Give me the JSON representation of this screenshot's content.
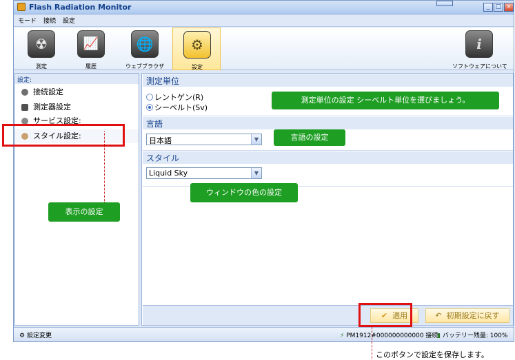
{
  "window": {
    "title": "Flash Radiation Monitor",
    "buttons": [
      "_",
      "□",
      "×"
    ]
  },
  "menu": [
    "モード",
    "接続",
    "設定"
  ],
  "toolbar": {
    "items": [
      {
        "label": "測定",
        "icon": "radiation-icon"
      },
      {
        "label": "履歴",
        "icon": "history-chart-icon"
      },
      {
        "label": "ウェブブラウザ",
        "icon": "globe-icon"
      },
      {
        "label": "設定",
        "icon": "gear-icon",
        "selected": true
      }
    ],
    "about": {
      "label": "ソフトウェアについて",
      "icon": "info-icon"
    }
  },
  "sidebar": {
    "header": "設定:",
    "items": [
      {
        "label": "接続設定",
        "icon": "connection-icon"
      },
      {
        "label": "測定器設定",
        "icon": "device-icon"
      },
      {
        "label": "サービス設定:",
        "icon": "service-icon"
      },
      {
        "label": "スタイル設定:",
        "icon": "style-icon",
        "selected": true
      }
    ]
  },
  "unit_section": {
    "header": "測定単位",
    "options": [
      {
        "label": "レントゲン(R)",
        "checked": false
      },
      {
        "label": "シーベルト(Sv)",
        "checked": true
      }
    ]
  },
  "language_section": {
    "header": "言語",
    "value": "日本語"
  },
  "style_section": {
    "header": "スタイル",
    "value": "Liquid Sky"
  },
  "buttons": {
    "apply": "適用",
    "reset": "初期設定に戻す"
  },
  "status": {
    "left": "設定変更",
    "connection": "PM1912#000000000000 接続",
    "battery": "バッテリー残量: 100%"
  },
  "callouts": {
    "unit": "測定単位の設定 シーベルト単位を選びましょう。",
    "language": "言語の設定",
    "style": "ウィンドウの色の設定",
    "display": "表示の設定",
    "save": "このボタンで設定を保存します。"
  },
  "colors": {
    "callout": "#1f9e24",
    "highlight": "#e01010",
    "accent": "#15428b"
  }
}
